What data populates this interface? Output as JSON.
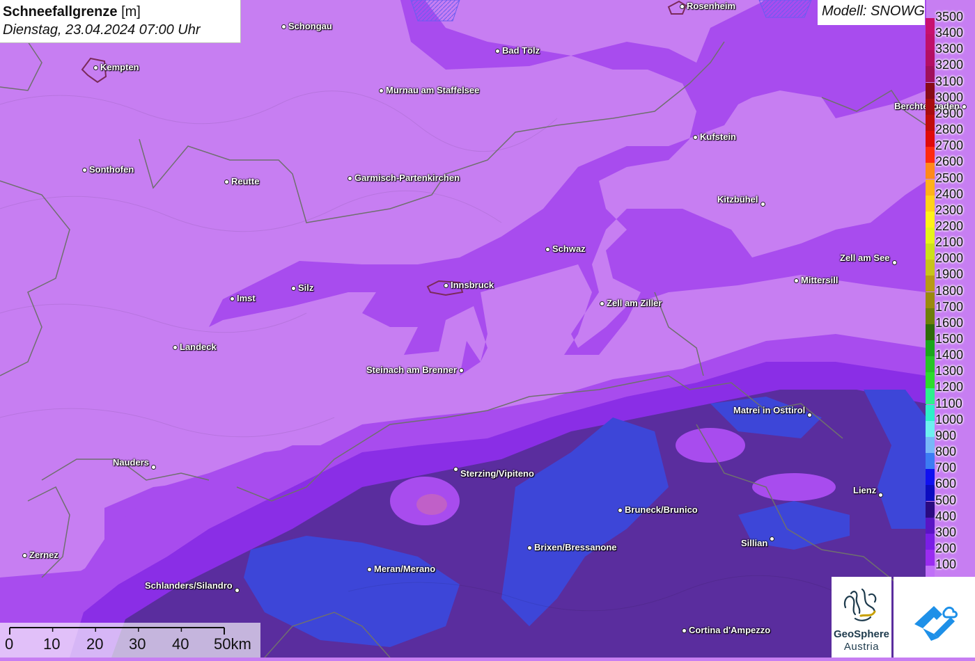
{
  "header": {
    "title": "Schneefallgrenze",
    "unit": "[m]",
    "datetime": "Dienstag, 23.04.2024 07:00 Uhr",
    "model": "Modell: SNOWGRID"
  },
  "legend": {
    "levels": [
      {
        "value": "3500",
        "color": "#c8106e"
      },
      {
        "value": "3400",
        "color": "#c0106a"
      },
      {
        "value": "3300",
        "color": "#b40f64"
      },
      {
        "value": "3200",
        "color": "#a0105a"
      },
      {
        "value": "3100",
        "color": "#880a18"
      },
      {
        "value": "3000",
        "color": "#a80c10"
      },
      {
        "value": "2900",
        "color": "#c00c0c"
      },
      {
        "value": "2800",
        "color": "#e00a0a"
      },
      {
        "value": "2700",
        "color": "#ff2a10"
      },
      {
        "value": "2600",
        "color": "#ff8a1a"
      },
      {
        "value": "2500",
        "color": "#ffb21a"
      },
      {
        "value": "2400",
        "color": "#ffd21a"
      },
      {
        "value": "2300",
        "color": "#fff21a"
      },
      {
        "value": "2200",
        "color": "#e6f41a"
      },
      {
        "value": "2100",
        "color": "#cce01a"
      },
      {
        "value": "2000",
        "color": "#c8c41a"
      },
      {
        "value": "1900",
        "color": "#b89a14"
      },
      {
        "value": "1800",
        "color": "#9a8a0e"
      },
      {
        "value": "1700",
        "color": "#6e7e0a"
      },
      {
        "value": "1600",
        "color": "#2e6a0a"
      },
      {
        "value": "1500",
        "color": "#1aa61a"
      },
      {
        "value": "1400",
        "color": "#26c426"
      },
      {
        "value": "1300",
        "color": "#2cdc2c"
      },
      {
        "value": "1200",
        "color": "#2ef08c"
      },
      {
        "value": "1100",
        "color": "#2ef0c8"
      },
      {
        "value": "1000",
        "color": "#6ef0f0"
      },
      {
        "value": "900",
        "color": "#78b8f8"
      },
      {
        "value": "800",
        "color": "#3c7cf4"
      },
      {
        "value": "700",
        "color": "#1010f0"
      },
      {
        "value": "600",
        "color": "#0c0cc0"
      },
      {
        "value": "500",
        "color": "#2a0a80"
      },
      {
        "value": "400",
        "color": "#5a14c4"
      },
      {
        "value": "300",
        "color": "#7a1ee6"
      },
      {
        "value": "200",
        "color": "#9a2cf0"
      },
      {
        "value": "100",
        "color": "#c070f8"
      }
    ]
  },
  "map": {
    "places": [
      {
        "name": "Rosenheim",
        "side": "right"
      },
      {
        "name": "Schongau",
        "side": "right"
      },
      {
        "name": "Kempten",
        "side": "right"
      },
      {
        "name": "Bad Tölz",
        "side": "right"
      },
      {
        "name": "Murnau am Staffelsee",
        "side": "right"
      },
      {
        "name": "Berchtesgaden",
        "side": "left"
      },
      {
        "name": "Kufstein",
        "side": "right"
      },
      {
        "name": "Sonthofen",
        "side": "right"
      },
      {
        "name": "Reutte",
        "side": "right"
      },
      {
        "name": "Garmisch-Partenkirchen",
        "side": "right"
      },
      {
        "name": "Kitzbühel",
        "side": "left"
      },
      {
        "name": "Schwaz",
        "side": "right"
      },
      {
        "name": "Zell am See",
        "side": "left"
      },
      {
        "name": "Mittersill",
        "side": "right"
      },
      {
        "name": "Innsbruck",
        "side": "right"
      },
      {
        "name": "Silz",
        "side": "right"
      },
      {
        "name": "Imst",
        "side": "right"
      },
      {
        "name": "Zell am Ziller",
        "side": "right"
      },
      {
        "name": "Landeck",
        "side": "right"
      },
      {
        "name": "Steinach am Brenner",
        "side": "left"
      },
      {
        "name": "Matrei in Osttirol",
        "side": "left"
      },
      {
        "name": "Nauders",
        "side": "left"
      },
      {
        "name": "Sterzing/Vipiteno",
        "side": "right"
      },
      {
        "name": "Lienz",
        "side": "left"
      },
      {
        "name": "Bruneck/Brunico",
        "side": "right"
      },
      {
        "name": "Sillian",
        "side": "left"
      },
      {
        "name": "Brixen/Bressanone",
        "side": "right"
      },
      {
        "name": "Zernez",
        "side": "right"
      },
      {
        "name": "Meran/Merano",
        "side": "right"
      },
      {
        "name": "Schlanders/Silandro",
        "side": "left"
      },
      {
        "name": "Cortina d'Ampezzo",
        "side": "right"
      }
    ]
  },
  "scalebar": {
    "labels": [
      "0",
      "10",
      "20",
      "30",
      "40",
      "50km"
    ]
  },
  "logos": {
    "geosphere_line1": "GeoSphere",
    "geosphere_line2": "Austria",
    "geosphere_color": "#1d3a4c",
    "app_icon_color": "#1e90e8"
  }
}
